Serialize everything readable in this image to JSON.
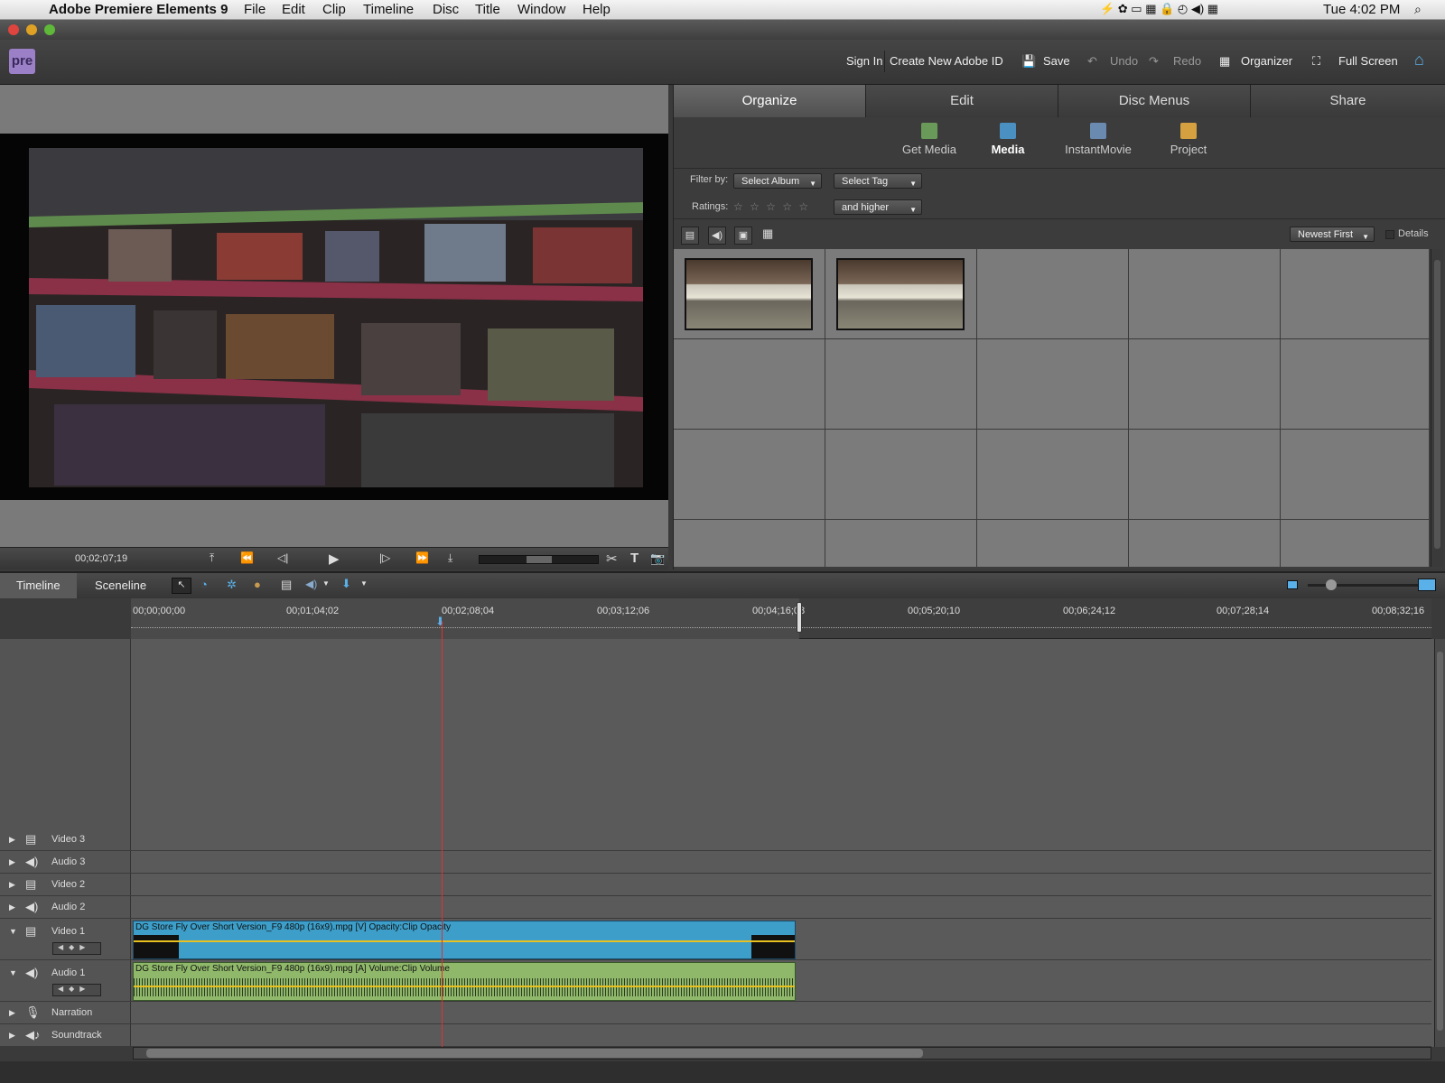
{
  "menubar": {
    "app_name": "Adobe Premiere Elements 9",
    "items": [
      "File",
      "Edit",
      "Clip",
      "Timeline",
      "Disc",
      "Title",
      "Window",
      "Help"
    ],
    "clock": "Tue 4:02 PM"
  },
  "appbar": {
    "logo": "pre",
    "sign_in": "Sign In",
    "create_id": "Create New Adobe ID",
    "save": "Save",
    "undo": "Undo",
    "redo": "Redo",
    "organizer": "Organizer",
    "full_screen": "Full Screen"
  },
  "monitor": {
    "timecode": "00;02;07;19"
  },
  "panel": {
    "tabs": [
      "Organize",
      "Edit",
      "Disc Menus",
      "Share"
    ],
    "active_tab": "Organize",
    "subtabs": [
      "Get Media",
      "Media",
      "InstantMovie",
      "Project"
    ],
    "active_subtab": "Media",
    "filter_label": "Filter by:",
    "album_select": "Select Album",
    "tag_select": "Select Tag",
    "ratings_label": "Ratings:",
    "rating_stars": "☆ ☆ ☆ ☆ ☆",
    "rating_mode": "and higher",
    "sort_select": "Newest First",
    "details_label": "Details"
  },
  "timeline": {
    "tabs": [
      "Timeline",
      "Sceneline"
    ],
    "active_tab": "Timeline",
    "ruler": [
      "00;00;00;00",
      "00;01;04;02",
      "00;02;08;04",
      "00;03;12;06",
      "00;04;16;08",
      "00;05;20;10",
      "00;06;24;12",
      "00;07;28;14",
      "00;08;32;16"
    ],
    "tracks": [
      "Video 3",
      "Audio 3",
      "Video 2",
      "Audio 2",
      "Video 1",
      "Audio 1",
      "Narration",
      "Soundtrack"
    ],
    "video_clip": "DG Store Fly Over Short Version_F9 480p (16x9).mpg [V]",
    "video_prop": "Opacity:Clip Opacity",
    "audio_clip": "DG Store Fly Over Short Version_F9 480p (16x9).mpg [A]",
    "audio_prop": "Volume:Clip Volume"
  },
  "colors": {
    "video_clip": "#3c9ec9",
    "audio_clip": "#8fb86a",
    "playhead": "#e23030",
    "logo_bg": "#9b7fc7"
  }
}
